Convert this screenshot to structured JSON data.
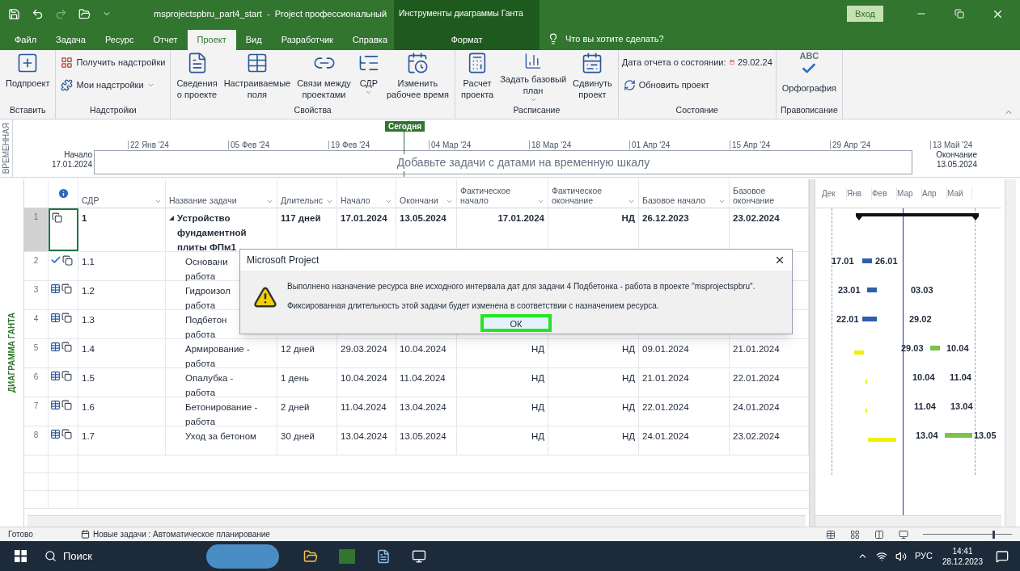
{
  "window": {
    "title": "msprojectspbru_part4_start  -  Project профессиональный",
    "context_group": "Инструменты диаграммы Ганта",
    "signin": "Вход"
  },
  "tabs": [
    {
      "label": "Файл",
      "kind": "file",
      "selected": false
    },
    {
      "label": "Задача",
      "kind": "normal",
      "selected": false
    },
    {
      "label": "Ресурс",
      "kind": "normal",
      "selected": false
    },
    {
      "label": "Отчет",
      "kind": "normal",
      "selected": false
    },
    {
      "label": "Проект",
      "kind": "normal",
      "selected": true
    },
    {
      "label": "Вид",
      "kind": "normal",
      "selected": false
    },
    {
      "label": "Разработчик",
      "kind": "normal",
      "selected": false
    },
    {
      "label": "Справка",
      "kind": "normal",
      "selected": false
    },
    {
      "label": "Формат",
      "kind": "context",
      "selected": false
    }
  ],
  "tell_me": "Что вы хотите сделать?",
  "ribbon": [
    {
      "label": "Вставить",
      "items": [
        {
          "kind": "large",
          "label": "Подпроект"
        }
      ]
    },
    {
      "label": "Надстройки",
      "items": [
        {
          "kind": "small",
          "label": "Получить надстройки"
        },
        {
          "kind": "small",
          "label": "Мои надстройки",
          "dropdown": true
        }
      ]
    },
    {
      "label": "Свойства",
      "items": [
        {
          "kind": "large",
          "label": "Сведения\nо проекте"
        },
        {
          "kind": "large",
          "label": "Настраиваемые\nполя"
        },
        {
          "kind": "large",
          "label": "Связи между\nпроектами"
        },
        {
          "kind": "large",
          "label": "СДР",
          "dropdown": true
        },
        {
          "kind": "large",
          "label": "Изменить\nрабочее время"
        }
      ]
    },
    {
      "label": "Расписание",
      "items": [
        {
          "kind": "large",
          "label": "Расчет\nпроекта"
        },
        {
          "kind": "large",
          "label": "Задать базовый\nплан",
          "dropdown": true
        },
        {
          "kind": "large",
          "label": "Сдвинуть\nпроект"
        }
      ]
    },
    {
      "label": "Состояние",
      "items": [
        {
          "kind": "date",
          "label": "Дата отчета о состоянии:",
          "value": "29.02.24"
        },
        {
          "kind": "small",
          "label": "Обновить проект"
        }
      ]
    },
    {
      "label": "Правописание",
      "items": [
        {
          "kind": "spell",
          "label": "Орфография",
          "icon_text": "ABC"
        }
      ]
    }
  ],
  "timeline": {
    "label": "ВРЕМЕННАЯ",
    "today": "Сегодня",
    "ticks": [
      "22 Янв '24",
      "05 Фев '24",
      "19 Фев '24",
      "04 Мар '24",
      "18 Мар '24",
      "01 Апр '24",
      "15 Апр '24",
      "29 Апр '24",
      "13 Май '24"
    ],
    "start_label": "Начало",
    "start_date": "17.01.2024",
    "end_label": "Окончание",
    "end_date": "13.05.2024",
    "hint": "Добавьте задачи с датами на временную шкалу"
  },
  "view_label": "ДИАГРАММА ГАНТА",
  "columns": [
    {
      "label": "СДР",
      "filter": true
    },
    {
      "label": "Название задачи",
      "filter": true
    },
    {
      "label": "Длительнс",
      "filter": true
    },
    {
      "label": "Начало",
      "filter": true
    },
    {
      "label": "Окончани",
      "filter": true
    },
    {
      "label": "Фактическое\nначало",
      "filter": true
    },
    {
      "label": "Фактическое\nокончание",
      "filter": true
    },
    {
      "label": "Базовое начало",
      "filter": true
    },
    {
      "label": "Базовое\nокончание"
    }
  ],
  "tasks": [
    {
      "num": "1",
      "kind": "plain",
      "wbs": "1",
      "name": "Устройство\nфундаментной\nплиты ФПм1",
      "summary": true,
      "selected": true,
      "duration": "117 дней",
      "start": "17.01.2024",
      "finish": "13.05.2024",
      "actual_start": "17.01.2024",
      "actual_finish": "НД",
      "baseline_start": "26.12.2023",
      "baseline_finish": "23.02.2024"
    },
    {
      "num": "2",
      "kind": "done",
      "wbs": "1.1",
      "name": "Основани\nработа",
      "summary": false,
      "selected": false
    },
    {
      "num": "3",
      "wbs": "1.2",
      "kind": "constrained",
      "name": "Гидроизол\nработа",
      "summary": false,
      "selected": false
    },
    {
      "num": "4",
      "wbs": "1.3",
      "kind": "constrained",
      "name": "Подбетон\nработа",
      "summary": false,
      "selected": false
    },
    {
      "num": "5",
      "wbs": "1.4",
      "kind": "constrained",
      "name": "Армирование -\nработа",
      "summary": false,
      "selected": false,
      "duration": "12 дней",
      "start": "29.03.2024",
      "finish": "10.04.2024",
      "actual_start": "НД",
      "actual_finish": "НД",
      "baseline_start": "09.01.2024",
      "baseline_finish": "21.01.2024"
    },
    {
      "num": "6",
      "wbs": "1.5",
      "kind": "constrained",
      "name": "Опалубка -\nработа",
      "summary": false,
      "selected": false,
      "duration": "1 день",
      "start": "10.04.2024",
      "finish": "11.04.2024",
      "actual_start": "НД",
      "actual_finish": "НД",
      "baseline_start": "21.01.2024",
      "baseline_finish": "22.01.2024"
    },
    {
      "num": "7",
      "wbs": "1.6",
      "kind": "constrained",
      "name": "Бетонирование -\nработа",
      "summary": false,
      "selected": false,
      "duration": "2 дней",
      "start": "11.04.2024",
      "finish": "13.04.2024",
      "actual_start": "НД",
      "actual_finish": "НД",
      "baseline_start": "22.01.2024",
      "baseline_finish": "24.01.2024"
    },
    {
      "num": "8",
      "wbs": "1.7",
      "kind": "constrained",
      "name": "Уход за бетоном",
      "summary": false,
      "selected": false,
      "duration": "30 дней",
      "start": "13.04.2024",
      "finish": "13.05.2024",
      "actual_start": "НД",
      "actual_finish": "НД",
      "baseline_start": "24.01.2024",
      "baseline_finish": "23.02.2024"
    }
  ],
  "gantt": {
    "months": [
      "Дек",
      "Янв",
      "Фев",
      "Мар",
      "Апр",
      "Май"
    ],
    "labels": [
      {
        "start": "17.01",
        "end": "26.01"
      },
      {
        "start": "23.01",
        "end": "03.03"
      },
      {
        "start": "22.01",
        "end": "29.02"
      },
      {
        "start": "29.03",
        "end": "10.04"
      },
      {
        "start": "10.04",
        "end": "11.04"
      },
      {
        "start": "11.04",
        "end": "13.04"
      },
      {
        "start": "13.04",
        "end": "13.05"
      }
    ]
  },
  "dialog": {
    "title": "Microsoft Project",
    "lines": [
      "Выполнено назначение ресурса вне исходного интервала дат для задачи 4 Подбетонка - работа в проекте \"msprojectspbru\".",
      "Фиксированная длительность этой задачи будет изменена в соответствии с назначением ресурса."
    ],
    "ok": "ОК",
    "highlighted": true
  },
  "status_bar": {
    "ready": "Готово",
    "mode": "Новые задачи : Автоматическое планирование",
    "zoom": {
      "level": 0.78
    }
  },
  "taskbar": {
    "search": "Поиск",
    "lang": "РУС",
    "time": "14:41",
    "date": "28.12.2023"
  }
}
